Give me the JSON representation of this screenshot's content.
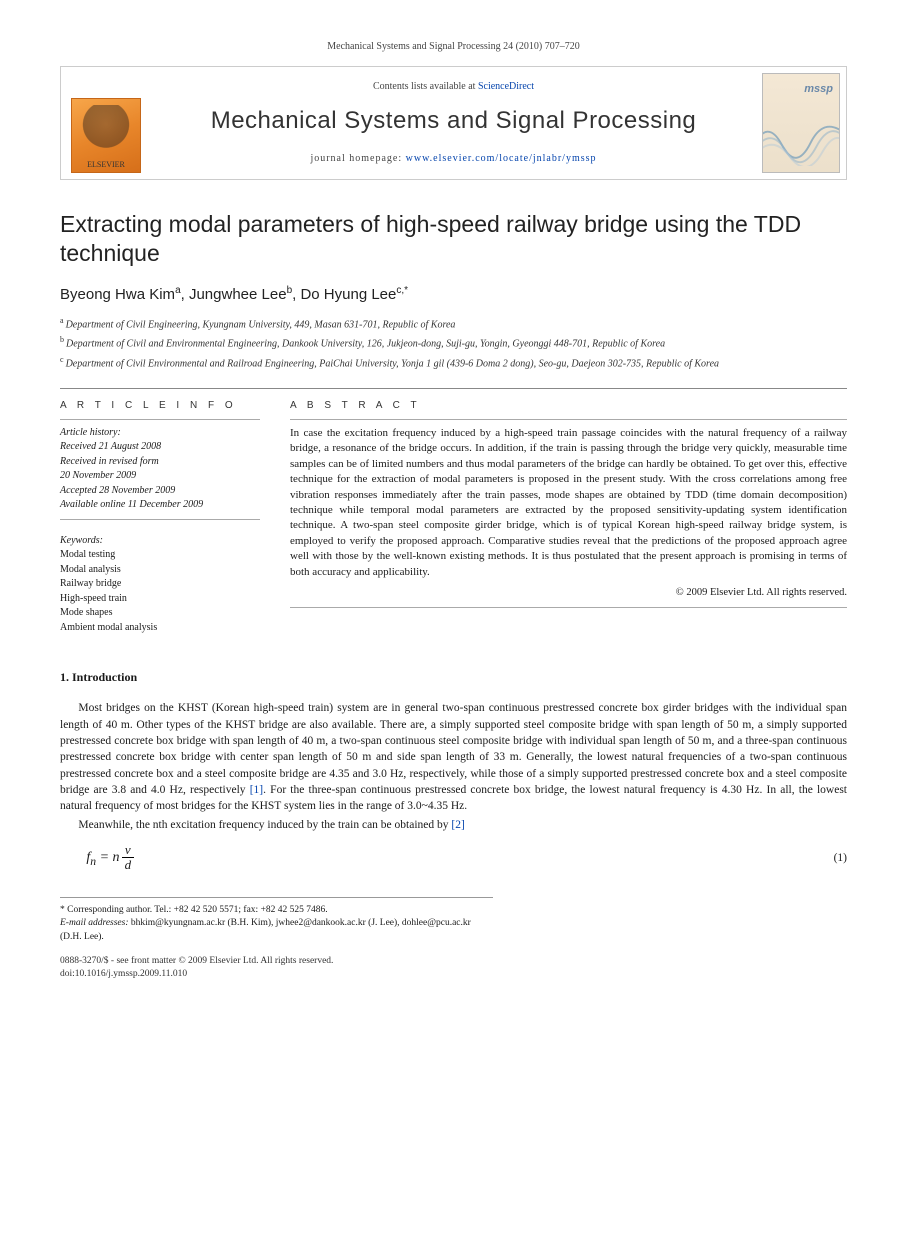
{
  "header": {
    "citation": "Mechanical Systems and Signal Processing 24 (2010) 707–720"
  },
  "banner": {
    "publisher_logo_label": "ELSEVIER",
    "contents_prefix": "Contents lists available at ",
    "contents_link": "ScienceDirect",
    "journal_name": "Mechanical Systems and Signal Processing",
    "homepage_prefix": "journal homepage: ",
    "homepage_url": "www.elsevier.com/locate/jnlabr/ymssp",
    "cover_abbrev": "mssp"
  },
  "title": "Extracting modal parameters of high-speed railway bridge using the TDD technique",
  "authors_line": {
    "a1": "Byeong Hwa Kim",
    "a1_sup": "a",
    "a2": "Jungwhee Lee",
    "a2_sup": "b",
    "a3": "Do Hyung Lee",
    "a3_sup": "c,*"
  },
  "affiliations": {
    "a": "Department of Civil Engineering, Kyungnam University, 449, Masan 631-701, Republic of Korea",
    "b": "Department of Civil and Environmental Engineering, Dankook University, 126, Jukjeon-dong, Suji-gu, Yongin, Gyeonggi 448-701, Republic of Korea",
    "c": "Department of Civil Environmental and Railroad Engineering, PaiChai University, Yonja 1 gil (439-6 Doma 2 dong), Seo-gu, Daejeon 302-735, Republic of Korea"
  },
  "article_info": {
    "heading": "A R T I C L E  I N F O",
    "history_label": "Article history:",
    "history": [
      "Received 21 August 2008",
      "Received in revised form",
      "20 November 2009",
      "Accepted 28 November 2009",
      "Available online 11 December 2009"
    ],
    "keywords_label": "Keywords:",
    "keywords": [
      "Modal testing",
      "Modal analysis",
      "Railway bridge",
      "High-speed train",
      "Mode shapes",
      "Ambient modal analysis"
    ]
  },
  "abstract": {
    "heading": "A B S T R A C T",
    "text": "In case the excitation frequency induced by a high-speed train passage coincides with the natural frequency of a railway bridge, a resonance of the bridge occurs. In addition, if the train is passing through the bridge very quickly, measurable time samples can be of limited numbers and thus modal parameters of the bridge can hardly be obtained. To get over this, effective technique for the extraction of modal parameters is proposed in the present study. With the cross correlations among free vibration responses immediately after the train passes, mode shapes are obtained by TDD (time domain decomposition) technique while temporal modal parameters are extracted by the proposed sensitivity-updating system identification technique. A two-span steel composite girder bridge, which is of typical Korean high-speed railway bridge system, is employed to verify the proposed approach. Comparative studies reveal that the predictions of the proposed approach agree well with those by the well-known existing methods. It is thus postulated that the present approach is promising in terms of both accuracy and applicability.",
    "copyright": "© 2009 Elsevier Ltd. All rights reserved."
  },
  "section1": {
    "heading": "1.  Introduction",
    "p1_a": "Most bridges on the KHST (Korean high-speed train) system are in general two-span continuous prestressed concrete box girder bridges with the individual span length of 40 m. Other types of the KHST bridge are also available. There are, a simply supported steel composite bridge with span length of 50 m, a simply supported prestressed concrete box bridge with span length of 40 m, a two-span continuous steel composite bridge with individual span length of 50 m, and a three-span continuous prestressed concrete box bridge with center span length of 50 m and side span length of 33 m. Generally, the lowest natural frequencies of a two-span continuous prestressed concrete box and a steel composite bridge are 4.35 and 3.0 Hz, respectively, while those of a simply supported prestressed concrete box and a steel composite bridge are 3.8 and 4.0 Hz, respectively ",
    "ref1": "[1]",
    "p1_b": ". For the three-span continuous prestressed concrete box bridge, the lowest natural frequency is 4.30 Hz. In all, the lowest natural frequency of most bridges for the KHST system lies in the range of 3.0~4.35 Hz.",
    "p2_a": "Meanwhile, the nth excitation frequency induced by the train can be obtained by ",
    "ref2": "[2]"
  },
  "equation": {
    "lhs": "f",
    "sub": "n",
    "eq": " = n",
    "num": "v",
    "den": "d",
    "number": "(1)"
  },
  "footnotes": {
    "corr_label": "* Corresponding author. Tel.: +82 42 520 5571; fax: +82 42 525 7486.",
    "email_label": "E-mail addresses:",
    "emails": " bhkim@kyungnam.ac.kr (B.H. Kim), jwhee2@dankook.ac.kr (J. Lee), dohlee@pcu.ac.kr (D.H. Lee)."
  },
  "bottom": {
    "issn_line": "0888-3270/$ - see front matter © 2009 Elsevier Ltd. All rights reserved.",
    "doi_line": "doi:10.1016/j.ymssp.2009.11.010"
  }
}
